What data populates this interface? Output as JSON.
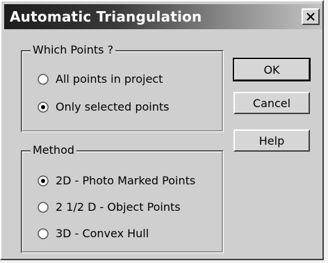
{
  "dialog": {
    "title": "Automatic Triangulation",
    "close_icon": "close-icon"
  },
  "which_points": {
    "legend": "Which Points ?",
    "options": [
      {
        "label": "All points in project",
        "selected": false
      },
      {
        "label": "Only selected points",
        "selected": true
      }
    ]
  },
  "method": {
    "legend": "Method",
    "options": [
      {
        "label": "2D - Photo Marked Points",
        "selected": true
      },
      {
        "label": "2 1/2 D - Object Points",
        "selected": false
      },
      {
        "label": "3D - Convex Hull",
        "selected": false
      }
    ]
  },
  "buttons": {
    "ok": "OK",
    "cancel": "Cancel",
    "help": "Help"
  }
}
